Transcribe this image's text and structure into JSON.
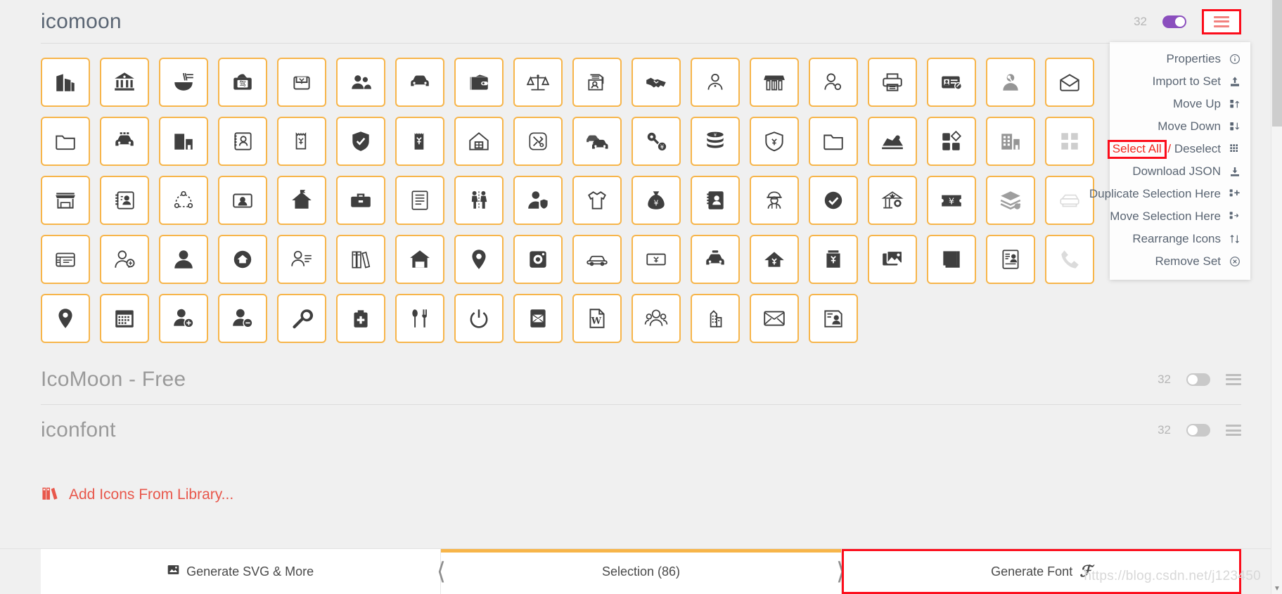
{
  "app": {
    "watermark": "https://blog.csdn.net/j123450"
  },
  "sets": [
    {
      "title": "icomoon",
      "count": "32",
      "toggle_on": true,
      "menu_open": true,
      "icons": [
        "buildings",
        "bank",
        "noodles",
        "driver-license",
        "cash-voucher",
        "people",
        "car",
        "wallet",
        "scales",
        "contact-folder",
        "handshake",
        "user-badge",
        "shop-stall",
        "user-link",
        "printer",
        "id-card-edit",
        "user-key",
        "envelope-open",
        "folder-outline",
        "police-car",
        "office-building",
        "contact-card",
        "receipt-yen",
        "shield-check",
        "receipt-filled",
        "home-window",
        "tools",
        "two-cars",
        "key-money",
        "coins-yen",
        "shield-yen",
        "folder",
        "delivery-truck",
        "blocks",
        "building-grid",
        "grid-squares",
        "store-front",
        "contacts-list",
        "network-nodes",
        "portrait-card",
        "home-flag",
        "briefcase",
        "document-lines",
        "people-stand",
        "user-shield",
        "shirt",
        "money-bag",
        "contact-book",
        "worker-helmet",
        "check-circle",
        "bank-building",
        "ticket-yen",
        "layers-gear",
        "card-lines",
        "user-badge-2",
        "user-solid",
        "cloud-home",
        "user-list",
        "books",
        "home-store",
        "map-pin",
        "camera-box",
        "car-outline",
        "banknote-yen",
        "taxi",
        "home-yen",
        "yen-bag",
        "photos",
        "book-closed",
        "id-document",
        "phone",
        "location-pin",
        "calendar",
        "user-add",
        "user-remove",
        "wrench",
        "medical-kit",
        "utensils",
        "power",
        "envelope-box",
        "word-doc",
        "users-group",
        "building-small",
        "envelope",
        "id-photo"
      ]
    },
    {
      "title": "IcoMoon - Free",
      "count": "32",
      "toggle_on": false,
      "menu_open": false,
      "icons": []
    },
    {
      "title": "iconfont",
      "count": "32",
      "toggle_on": false,
      "menu_open": false,
      "icons": []
    }
  ],
  "menu": {
    "items": [
      {
        "label": "Properties",
        "icon": "info-icon"
      },
      {
        "label": "Import to Set",
        "icon": "upload-icon"
      },
      {
        "label": "Move Up",
        "icon": "move-up-icon"
      },
      {
        "label": "Move Down",
        "icon": "move-down-icon"
      },
      {
        "label": "Select All",
        "label2": " / ",
        "label3": "Deselect",
        "icon": "grid-icon",
        "highlighted": true
      },
      {
        "label": "Download JSON",
        "icon": "download-icon"
      },
      {
        "label": "Duplicate Selection Here",
        "icon": "duplicate-icon"
      },
      {
        "label": "Move Selection Here",
        "icon": "move-selection-icon"
      },
      {
        "label": "Rearrange Icons",
        "icon": "rearrange-icon"
      },
      {
        "label": "Remove Set",
        "icon": "remove-icon"
      }
    ]
  },
  "library_link": {
    "label": "Add Icons From Library...",
    "icon": "books-icon"
  },
  "bottom_bar": {
    "tabs": [
      {
        "label": "Generate SVG & More",
        "icon": "image-icon",
        "active": false,
        "boxed": false
      },
      {
        "label": "Selection (86)",
        "icon": "",
        "active": true,
        "boxed": false
      },
      {
        "label": "Generate Font",
        "icon": "script-f",
        "active": false,
        "boxed": true
      }
    ]
  },
  "colors": {
    "accent_orange": "#f7b54a",
    "highlight_red": "#fc0d1b",
    "toggle_on": "#8b4fbe",
    "link_red": "#e8574b"
  }
}
